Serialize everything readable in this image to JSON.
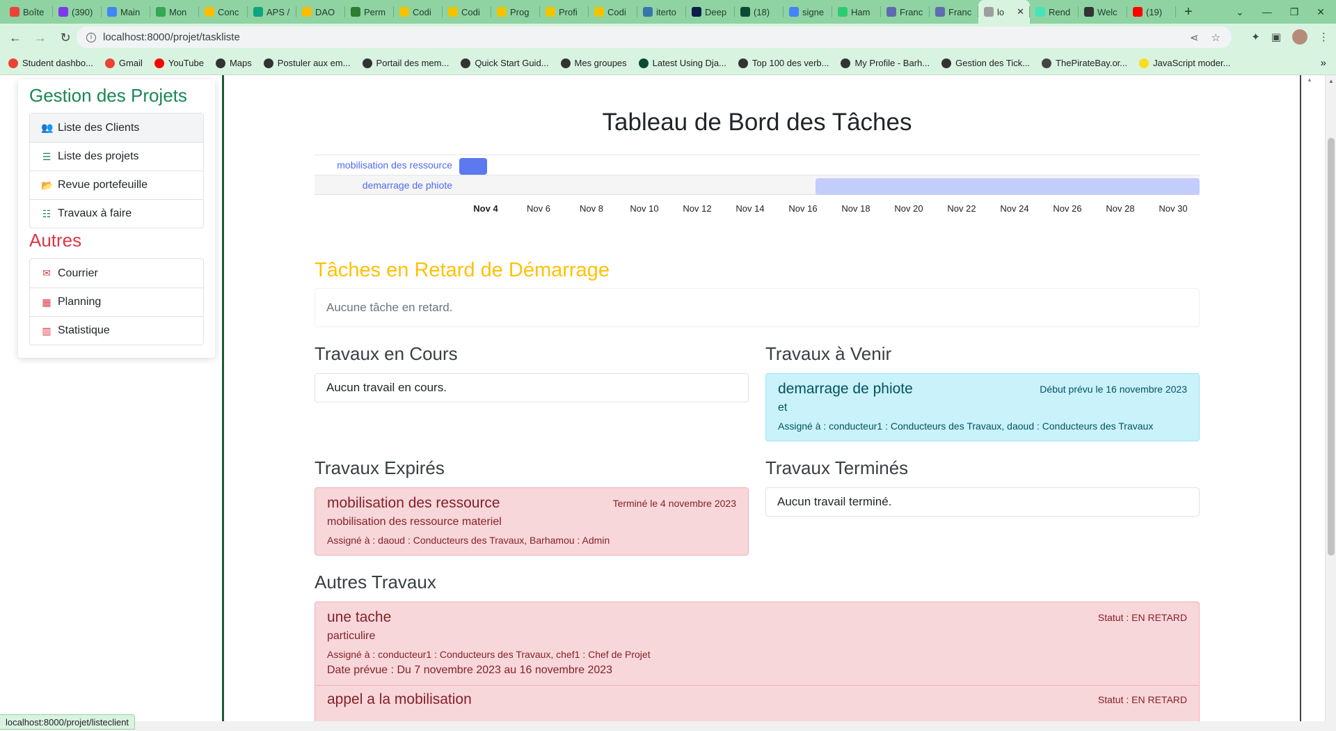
{
  "browser": {
    "tabs": [
      {
        "label": "Boîte",
        "color": "#ea4335"
      },
      {
        "label": "(390)",
        "color": "#7c3aed"
      },
      {
        "label": "Main",
        "color": "#4285f4"
      },
      {
        "label": "Mon",
        "color": "#34a853"
      },
      {
        "label": "Conc",
        "color": "#fbbc04"
      },
      {
        "label": "APS /",
        "color": "#10a37f"
      },
      {
        "label": "DAO",
        "color": "#fbbc04"
      },
      {
        "label": "Perm",
        "color": "#2e7d32"
      },
      {
        "label": "Codi",
        "color": "#f2c300"
      },
      {
        "label": "Codi",
        "color": "#f2c300"
      },
      {
        "label": "Prog",
        "color": "#f2c300"
      },
      {
        "label": "Profi",
        "color": "#f2c300"
      },
      {
        "label": "Codi",
        "color": "#f2c300"
      },
      {
        "label": "iterto",
        "color": "#3776ab"
      },
      {
        "label": "Deep",
        "color": "#0b1f4a"
      },
      {
        "label": "(18)",
        "color": "#0c4b33"
      },
      {
        "label": "signe",
        "color": "#4285f4"
      },
      {
        "label": "Ham",
        "color": "#2ecc71"
      },
      {
        "label": "Franc",
        "color": "#5f6bb0"
      },
      {
        "label": "Franc",
        "color": "#5f6bb0"
      },
      {
        "label": "lo",
        "color": "#9e9e9e"
      },
      {
        "label": "Rend",
        "color": "#46e3b7"
      },
      {
        "label": "Welc",
        "color": "#333333"
      },
      {
        "label": "(19)",
        "color": "#ff0000"
      }
    ],
    "active_tab_index": 20,
    "url": "localhost:8000/projet/taskliste",
    "bookmarks": [
      "Student dashbo...",
      "Gmail",
      "YouTube",
      "Maps",
      "Postuler aux em...",
      "Portail des mem...",
      "Quick Start Guid...",
      "Mes groupes",
      "Latest Using Dja...",
      "Top 100 des verb...",
      "My Profile - Barh...",
      "Gestion des Tick...",
      "ThePirateBay.or...",
      "JavaScript moder..."
    ],
    "status_url": "localhost:8000/projet/listeclient"
  },
  "sidebar": {
    "title": "Gestion des Projets",
    "items": [
      {
        "label": "Liste des Clients",
        "icon": "users-icon",
        "glyph": "👥"
      },
      {
        "label": "Liste des projets",
        "icon": "list-icon",
        "glyph": "☰"
      },
      {
        "label": "Revue portefeuille",
        "icon": "folder-open-icon",
        "glyph": "📂"
      },
      {
        "label": "Travaux à faire",
        "icon": "task-list-icon",
        "glyph": "☷"
      }
    ],
    "other_title": "Autres",
    "other_items": [
      {
        "label": "Courrier",
        "icon": "envelope-icon",
        "glyph": "✉"
      },
      {
        "label": "Planning",
        "icon": "calendar-icon",
        "glyph": "▦"
      },
      {
        "label": "Statistique",
        "icon": "bar-chart-icon",
        "glyph": "▥"
      }
    ]
  },
  "page": {
    "title": "Tableau de Bord des Tâches"
  },
  "gantt": {
    "tasks": [
      {
        "label": "mobilisation des ressource",
        "start": "Nov 4",
        "color": "#5c79f0"
      },
      {
        "label": "demarrage de phiote",
        "start": "Nov 16",
        "color": "#c3cdfb"
      }
    ],
    "ticks": [
      "Nov 4",
      "Nov 6",
      "Nov 8",
      "Nov 10",
      "Nov 12",
      "Nov 14",
      "Nov 16",
      "Nov 18",
      "Nov 20",
      "Nov 22",
      "Nov 24",
      "Nov 26",
      "Nov 28",
      "Nov 30"
    ]
  },
  "late_start": {
    "title": "Tâches en Retard de Démarrage",
    "empty": "Aucune tâche en retard."
  },
  "in_progress": {
    "title": "Travaux en Cours",
    "empty": "Aucun travail en cours."
  },
  "upcoming": {
    "title": "Travaux à Venir",
    "card": {
      "name": "demarrage de phiote",
      "date": "Début prévu le 16 novembre 2023",
      "desc": "et",
      "assigned": "Assigné à : conducteur1 : Conducteurs des Travaux, daoud : Conducteurs des Travaux"
    }
  },
  "expired": {
    "title": "Travaux Expirés",
    "card": {
      "name": "mobilisation des ressource",
      "date": "Terminé le 4 novembre 2023",
      "desc": "mobilisation des ressource materiel",
      "assigned": "Assigné à : daoud : Conducteurs des Travaux, Barhamou : Admin"
    }
  },
  "finished": {
    "title": "Travaux Terminés",
    "empty": "Aucun travail terminé."
  },
  "others": {
    "title": "Autres Travaux",
    "cards": [
      {
        "name": "une tache",
        "status": "Statut : EN RETARD",
        "desc": "particulire",
        "assigned": "Assigné à : conducteur1 : Conducteurs des Travaux, chef1 : Chef de Projet",
        "dates": "Date prévue : Du 7 novembre 2023 au 16 novembre 2023"
      },
      {
        "name": "appel a la mobilisation",
        "status": "Statut : EN RETARD"
      }
    ]
  }
}
